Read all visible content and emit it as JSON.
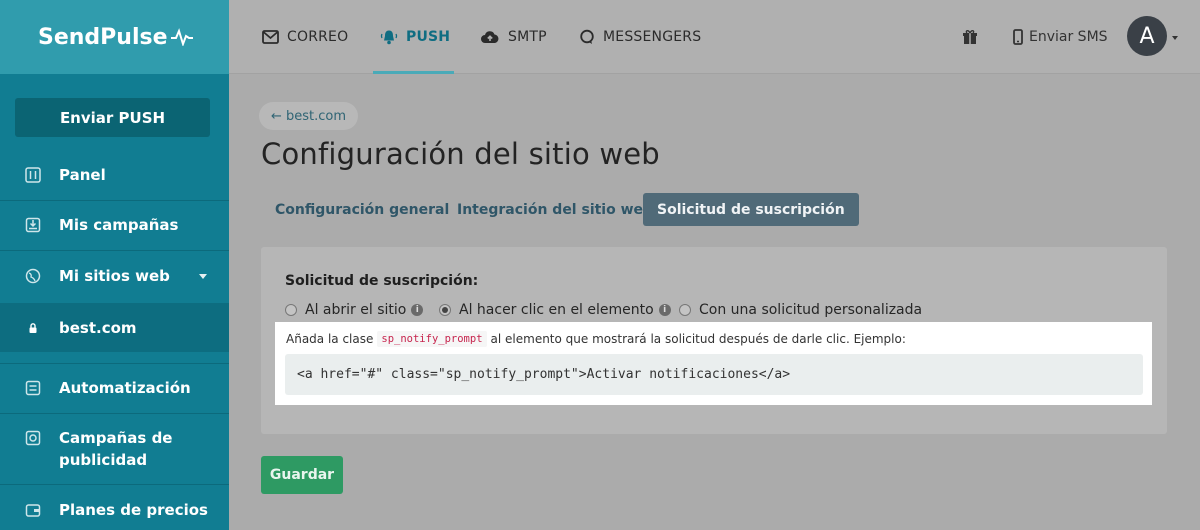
{
  "brand": {
    "name": "SendPulse"
  },
  "sidebar": {
    "cta": "Enviar PUSH",
    "items": [
      {
        "label": "Panel",
        "icon": "sliders-icon"
      },
      {
        "label": "Mis campañas",
        "icon": "inbox-icon"
      },
      {
        "label": "Mi sitios web",
        "icon": "globe-icon"
      },
      {
        "label": "best.com",
        "icon": "lock-icon"
      },
      {
        "label": "Automatización",
        "icon": "flow-icon"
      },
      {
        "label": "Campañas de publicidad",
        "icon": "target-icon"
      },
      {
        "label": "Planes de precios",
        "icon": "wallet-icon"
      }
    ]
  },
  "header": {
    "tabs": [
      {
        "label": "CORREO",
        "icon": "envelope-icon"
      },
      {
        "label": "PUSH",
        "icon": "bell-icon"
      },
      {
        "label": "SMTP",
        "icon": "cloud-upload-icon"
      },
      {
        "label": "MESSENGERS",
        "icon": "chat-icon"
      }
    ],
    "sms_label": "Enviar SMS",
    "avatar_initial": "A"
  },
  "main": {
    "breadcrumb": "← best.com",
    "title": "Configuración del sitio web",
    "subtabs": [
      "Configuración general",
      "Integración del sitio web",
      "Solicitud de suscripción"
    ],
    "section_heading": "Solicitud de suscripción:",
    "options": [
      {
        "label": "Al abrir el sitio",
        "checked": false,
        "info": true
      },
      {
        "label": "Al hacer clic en el elemento",
        "checked": true,
        "info": true
      },
      {
        "label": "Con una solicitud personalizada",
        "checked": false,
        "info": false
      }
    ],
    "hint_before": "Añada la clase",
    "hint_code": "sp_notify_prompt",
    "hint_after": "al elemento que mostrará la solicitud después de darle clic. Ejemplo:",
    "code_example": "<a href=\"#\" class=\"sp_notify_prompt\">Activar notificaciones</a>",
    "save_label": "Guardar"
  },
  "colors": {
    "sidebar": "#117d92",
    "accent": "#0f6d82",
    "save": "#2e9a63",
    "active_subtab": "#506a78"
  }
}
